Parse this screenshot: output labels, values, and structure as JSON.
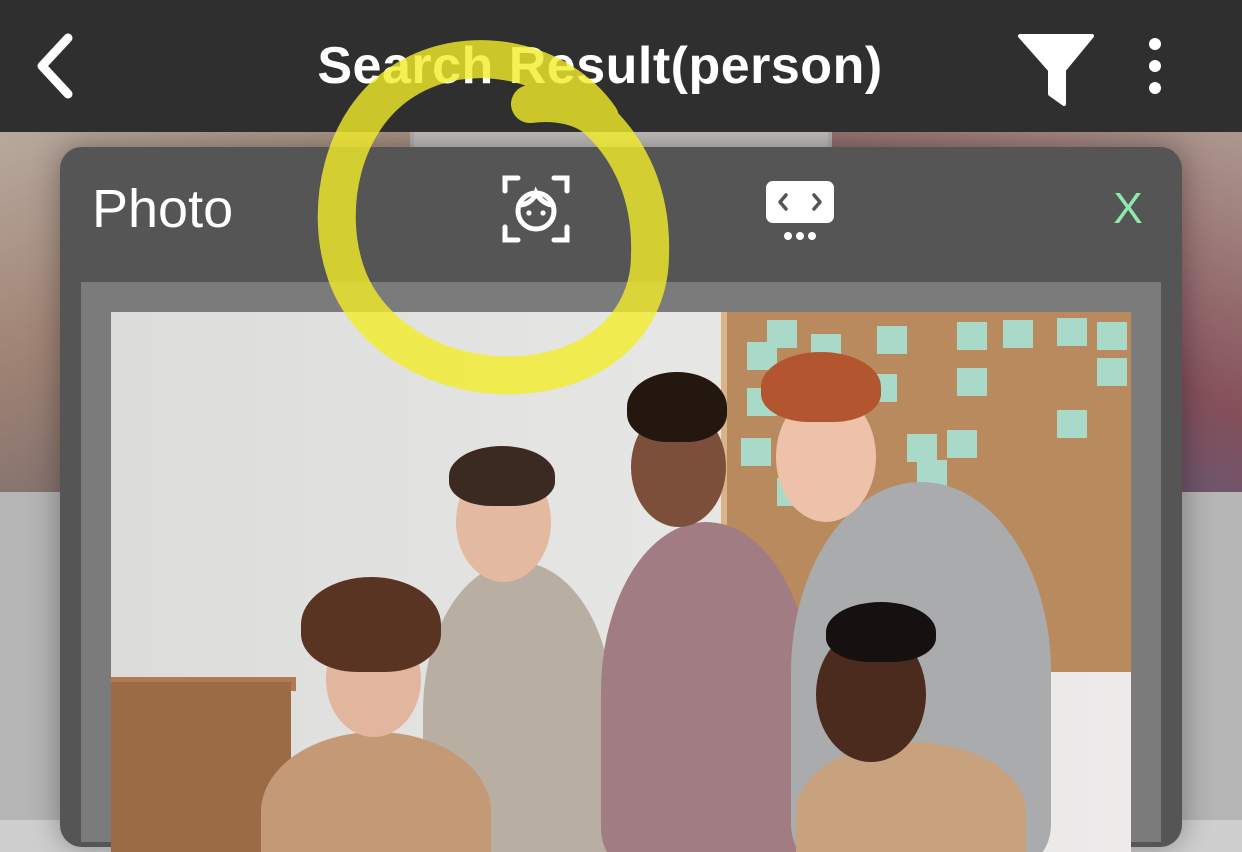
{
  "header": {
    "title": "Search Result(person)",
    "back_icon": "chevron-left-icon",
    "filter_icon": "filter-funnel-icon",
    "more_icon": "more-vertical-icon"
  },
  "dialog": {
    "title": "Photo",
    "face_icon": "face-detect-icon",
    "slideshow_icon": "slideshow-icon",
    "close_label": "X"
  },
  "colors": {
    "appbar_bg": "#2f2f2f",
    "dialog_bg": "#555555",
    "close_accent": "#8ee8b0",
    "highlight": "#f2ee2a"
  }
}
